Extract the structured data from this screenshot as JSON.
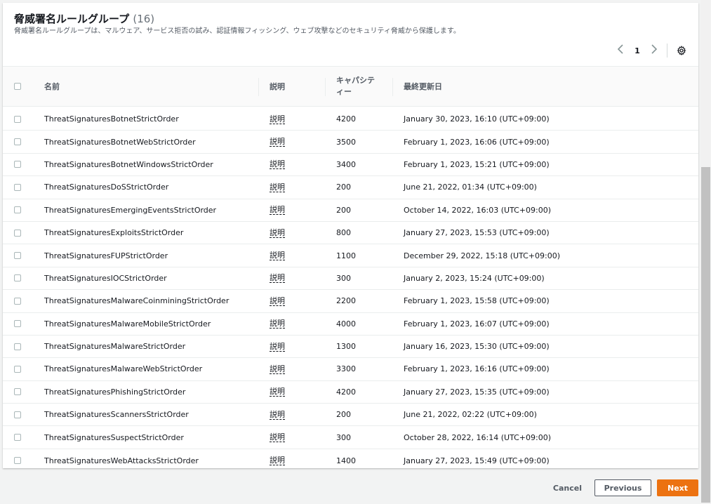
{
  "header": {
    "title": "脅威署名ルールグループ",
    "count": "(16)",
    "description": "脅威署名ルールグループは、マルウェア、サービス拒否の試み、認証情報フィッシング、ウェブ攻撃などのセキュリティ脅威から保護します。"
  },
  "pagination": {
    "current_page": "1",
    "prev_icon": "chevron-left-icon",
    "next_icon": "chevron-right-icon",
    "settings_icon": "gear-icon"
  },
  "columns": {
    "name": "名前",
    "description": "説明",
    "capacity": "キャパシティー",
    "last_updated": "最終更新日"
  },
  "rows": [
    {
      "name": "ThreatSignaturesBotnetStrictOrder",
      "desc": "説明",
      "capacity": "4200",
      "updated": "January 30, 2023, 16:10 (UTC+09:00)"
    },
    {
      "name": "ThreatSignaturesBotnetWebStrictOrder",
      "desc": "説明",
      "capacity": "3500",
      "updated": "February 1, 2023, 16:06 (UTC+09:00)"
    },
    {
      "name": "ThreatSignaturesBotnetWindowsStrictOrder",
      "desc": "説明",
      "capacity": "3400",
      "updated": "February 1, 2023, 15:21 (UTC+09:00)"
    },
    {
      "name": "ThreatSignaturesDoSStrictOrder",
      "desc": "説明",
      "capacity": "200",
      "updated": "June 21, 2022, 01:34 (UTC+09:00)"
    },
    {
      "name": "ThreatSignaturesEmergingEventsStrictOrder",
      "desc": "説明",
      "capacity": "200",
      "updated": "October 14, 2022, 16:03 (UTC+09:00)"
    },
    {
      "name": "ThreatSignaturesExploitsStrictOrder",
      "desc": "説明",
      "capacity": "800",
      "updated": "January 27, 2023, 15:53 (UTC+09:00)"
    },
    {
      "name": "ThreatSignaturesFUPStrictOrder",
      "desc": "説明",
      "capacity": "1100",
      "updated": "December 29, 2022, 15:18 (UTC+09:00)"
    },
    {
      "name": "ThreatSignaturesIOCStrictOrder",
      "desc": "説明",
      "capacity": "300",
      "updated": "January 2, 2023, 15:24 (UTC+09:00)"
    },
    {
      "name": "ThreatSignaturesMalwareCoinminingStrictOrder",
      "desc": "説明",
      "capacity": "2200",
      "updated": "February 1, 2023, 15:58 (UTC+09:00)"
    },
    {
      "name": "ThreatSignaturesMalwareMobileStrictOrder",
      "desc": "説明",
      "capacity": "4000",
      "updated": "February 1, 2023, 16:07 (UTC+09:00)"
    },
    {
      "name": "ThreatSignaturesMalwareStrictOrder",
      "desc": "説明",
      "capacity": "1300",
      "updated": "January 16, 2023, 15:30 (UTC+09:00)"
    },
    {
      "name": "ThreatSignaturesMalwareWebStrictOrder",
      "desc": "説明",
      "capacity": "3300",
      "updated": "February 1, 2023, 16:16 (UTC+09:00)"
    },
    {
      "name": "ThreatSignaturesPhishingStrictOrder",
      "desc": "説明",
      "capacity": "4200",
      "updated": "January 27, 2023, 15:35 (UTC+09:00)"
    },
    {
      "name": "ThreatSignaturesScannersStrictOrder",
      "desc": "説明",
      "capacity": "200",
      "updated": "June 21, 2022, 02:22 (UTC+09:00)"
    },
    {
      "name": "ThreatSignaturesSuspectStrictOrder",
      "desc": "説明",
      "capacity": "300",
      "updated": "October 28, 2022, 16:14 (UTC+09:00)"
    },
    {
      "name": "ThreatSignaturesWebAttacksStrictOrder",
      "desc": "説明",
      "capacity": "1400",
      "updated": "January 27, 2023, 15:49 (UTC+09:00)"
    }
  ],
  "footer": {
    "cancel_label": "Cancel",
    "previous_label": "Previous",
    "next_label": "Next"
  },
  "colors": {
    "primary_button": "#ec7211",
    "text": "#16191f",
    "muted": "#545b64"
  }
}
